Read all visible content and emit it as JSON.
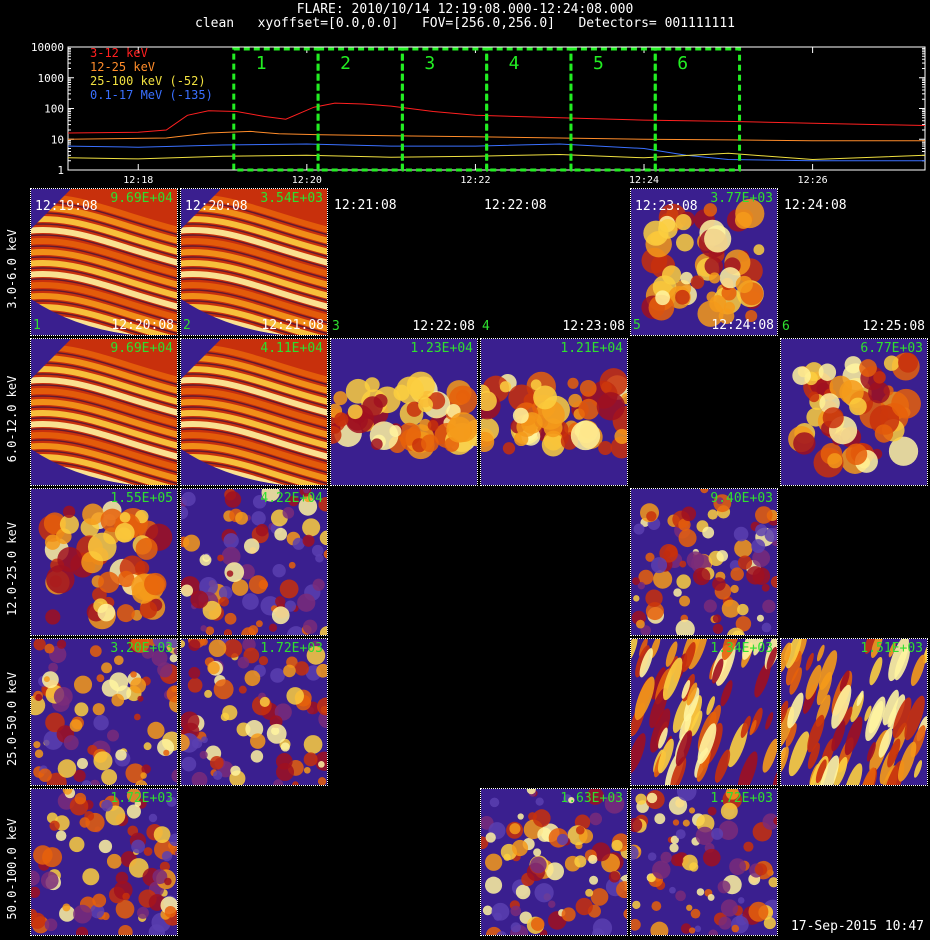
{
  "header": {
    "line1": "FLARE: 2010/10/14 12:19:08.000-12:24:08.000",
    "line2": "clean   xyoffset=[0.0,0.0]   FOV=[256.0,256.0]   Detectors= 001111111"
  },
  "chart_data": [
    {
      "type": "line",
      "title": "",
      "y_scale": "log",
      "ylim": [
        1,
        10000
      ],
      "y_ticks": [
        "1",
        "10",
        "100",
        "1000",
        "10000"
      ],
      "xlim": [
        "12:17:10",
        "12:27:20"
      ],
      "x_ticks": [
        "12:18",
        "12:20",
        "12:22",
        "12:24",
        "12:26"
      ],
      "legend_position": "top-left",
      "series": [
        {
          "name": "3-12 keV",
          "color": "#ff2020",
          "x": [
            "12:17:10",
            "12:18:00",
            "12:18:20",
            "12:18:35",
            "12:18:50",
            "12:19:10",
            "12:19:30",
            "12:19:45",
            "12:20:05",
            "12:20:20",
            "12:20:40",
            "12:21:00",
            "12:21:30",
            "12:22:00",
            "12:23:00",
            "12:24:00",
            "12:25:00",
            "12:26:00",
            "12:27:20"
          ],
          "y": [
            16,
            17,
            20,
            60,
            85,
            80,
            55,
            45,
            110,
            150,
            140,
            120,
            80,
            60,
            50,
            42,
            38,
            33,
            28
          ]
        },
        {
          "name": "12-25 keV",
          "color": "#ff8c2a",
          "x": [
            "12:17:10",
            "12:18:20",
            "12:18:50",
            "12:19:20",
            "12:19:40",
            "12:20:10",
            "12:21:00",
            "12:22:00",
            "12:23:00",
            "12:24:00",
            "12:25:00",
            "12:26:00",
            "12:27:20"
          ],
          "y": [
            10,
            11,
            16,
            18,
            15,
            14,
            13,
            12,
            11,
            10,
            9.5,
            9,
            9
          ]
        },
        {
          "name": "25-100 keV (-52)",
          "color": "#f0e040",
          "x": [
            "12:17:10",
            "12:18:00",
            "12:19:00",
            "12:20:00",
            "12:21:00",
            "12:22:00",
            "12:23:00",
            "12:24:00",
            "12:25:00",
            "12:26:00",
            "12:27:20"
          ],
          "y": [
            2.5,
            2.3,
            2.8,
            3.0,
            2.6,
            2.8,
            3.2,
            2.5,
            3.5,
            2.2,
            3.0
          ]
        },
        {
          "name": "0.1-17 MeV (-135)",
          "color": "#3a70ff",
          "x": [
            "12:17:10",
            "12:18:00",
            "12:19:00",
            "12:20:00",
            "12:21:00",
            "12:22:00",
            "12:23:00",
            "12:24:00",
            "12:24:30",
            "12:25:00",
            "12:26:00",
            "12:27:20"
          ],
          "y": [
            6,
            5.5,
            6.5,
            7,
            6,
            6,
            7,
            5,
            3,
            2.2,
            2.0,
            2.0
          ]
        }
      ],
      "intervals": [
        {
          "label": "1",
          "start": "12:19:08",
          "end": "12:20:08",
          "color": "#22ee22"
        },
        {
          "label": "2",
          "start": "12:20:08",
          "end": "12:21:08",
          "color": "#22ee22"
        },
        {
          "label": "3",
          "start": "12:21:08",
          "end": "12:22:08",
          "color": "#22ee22"
        },
        {
          "label": "4",
          "start": "12:22:08",
          "end": "12:23:08",
          "color": "#22ee22"
        },
        {
          "label": "5",
          "start": "12:23:08",
          "end": "12:24:08",
          "color": "#22ee22"
        },
        {
          "label": "6",
          "start": "12:24:08",
          "end": "12:25:08",
          "color": "#22ee22"
        }
      ]
    }
  ],
  "image_grid": {
    "energy_bands": [
      "3.0-6.0 keV",
      "6.0-12.0 keV",
      "12.0-25.0 keV",
      "25.0-50.0 keV",
      "50.0-100.0 keV"
    ],
    "intervals": [
      {
        "number": "1",
        "start": "12:19:08",
        "end": "12:20:08"
      },
      {
        "number": "2",
        "start": "12:20:08",
        "end": "12:21:08"
      },
      {
        "number": "3",
        "start": "12:21:08",
        "end": "12:22:08"
      },
      {
        "number": "4",
        "start": "12:22:08",
        "end": "12:23:08"
      },
      {
        "number": "5",
        "start": "12:23:08",
        "end": "12:24:08"
      },
      {
        "number": "6",
        "start": "12:24:08",
        "end": "12:25:08"
      }
    ],
    "peaks": [
      [
        "9.69E+04",
        "3.54E+03",
        null,
        null,
        "3.77E+03",
        null
      ],
      [
        "9.69E+04",
        "4.11E+04",
        "1.23E+04",
        "1.21E+04",
        null,
        "6.77E+03"
      ],
      [
        "1.55E+05",
        "4.22E+04",
        null,
        null,
        "9.40E+03",
        null
      ],
      [
        "3.20E+03",
        "1.72E+03",
        null,
        null,
        "1.34E+03",
        "1.51E+03"
      ],
      [
        "1.72E+03",
        null,
        null,
        "1.63E+03",
        "1.72E+03",
        null
      ]
    ],
    "image_styles": [
      [
        "streak",
        "streak",
        null,
        null,
        "blob",
        null
      ],
      [
        "streak",
        "streak",
        "band",
        "band",
        null,
        "blob"
      ],
      [
        "blob",
        "noise",
        null,
        null,
        "noise",
        null
      ],
      [
        "noise",
        "noise",
        null,
        null,
        "stripe",
        "stripe"
      ],
      [
        "noise",
        null,
        null,
        "noise",
        "noise",
        null
      ]
    ]
  },
  "footer": {
    "timestamp": "17-Sep-2015 10:47"
  }
}
